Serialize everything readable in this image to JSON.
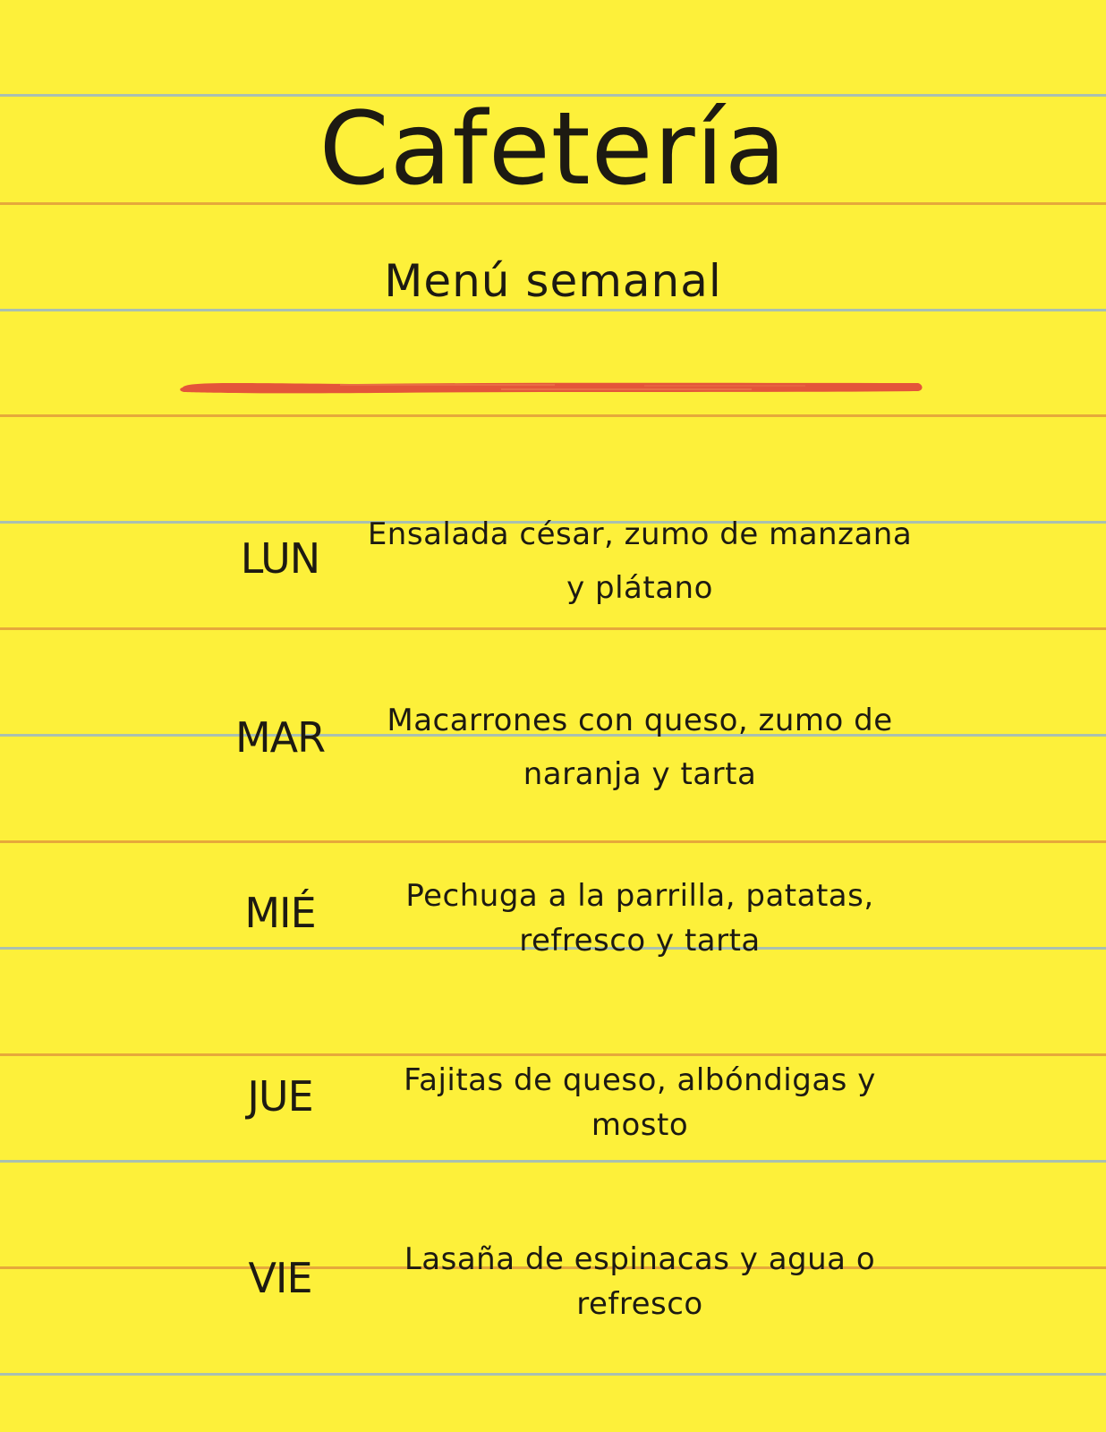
{
  "header": {
    "title": "Cafetería",
    "subtitle": "Menú semanal"
  },
  "colors": {
    "paper": "#fdf03a",
    "ink": "#1d1a12",
    "blue_rule": "#a9c0b0",
    "orange_rule": "#e6a93a",
    "brush_stroke": "#e4553a"
  },
  "menu": [
    {
      "day": "LUN",
      "meal": "Ensalada césar, zumo de manzana y plátano"
    },
    {
      "day": "MAR",
      "meal": "Macarrones con queso, zumo de naranja y tarta"
    },
    {
      "day": "MIÉ",
      "meal": "Pechuga a la parrilla, patatas, refresco y tarta"
    },
    {
      "day": "JUE",
      "meal": "Fajitas de queso, albóndigas y mosto"
    },
    {
      "day": "VIE",
      "meal": "Lasaña de espinacas y agua o refresco"
    }
  ]
}
